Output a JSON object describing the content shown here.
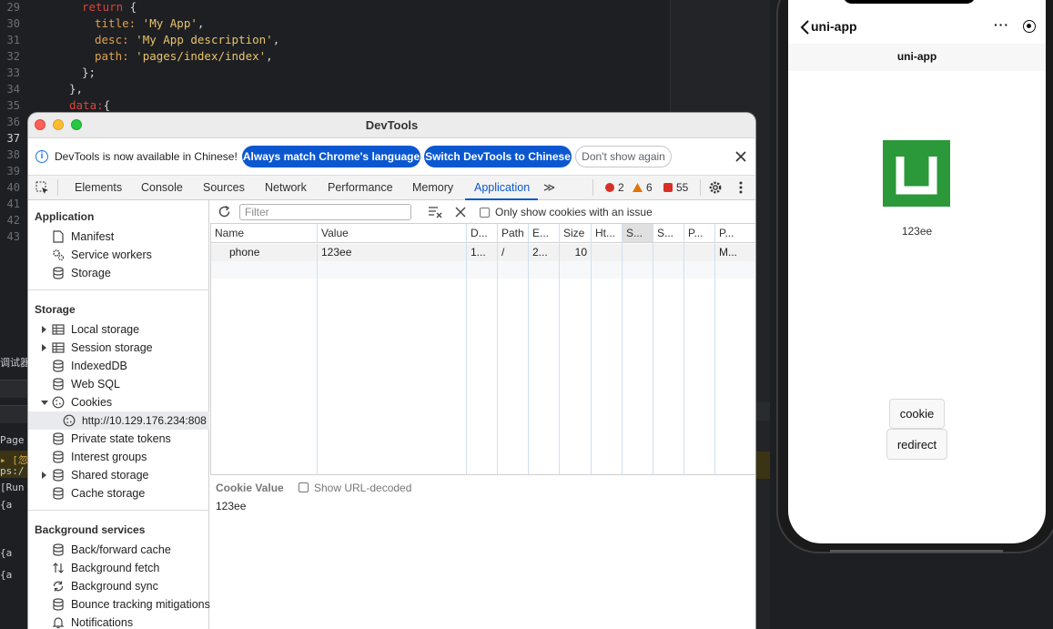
{
  "editor": {
    "line_numbers": [
      "29",
      "30",
      "31",
      "32",
      "33",
      "34",
      "35",
      "36",
      "37",
      "38",
      "39",
      "40",
      "41",
      "42",
      "43"
    ],
    "active_line": "37",
    "code": {
      "l29_kw": "return",
      "l29_brace": " {",
      "l30_key": "title:",
      "l30_val": " 'My App'",
      "l30_end": ",",
      "l31_key": "desc:",
      "l31_val": " 'My App description'",
      "l31_end": ",",
      "l32_key": "path:",
      "l32_val": " 'pages/index/index'",
      "l32_end": ",",
      "l33": "};",
      "l34": "},",
      "l35_key": "data:",
      "l35_brace": "{"
    }
  },
  "console_peek": {
    "label": "调试器",
    "page": "Page",
    "warn": "▸ [忽",
    "ps": "ps:/",
    "run": "[Run",
    "obj": "{a"
  },
  "phone": {
    "nav_title": "uni-app",
    "capsule_dots": "···",
    "page_header": "uni-app",
    "text": "123ee",
    "cookie_button": "cookie",
    "redirect_button": "redirect"
  },
  "devtools": {
    "window_title": "DevTools",
    "infobar": {
      "message": "DevTools is now available in Chinese!",
      "btn_match": "Always match Chrome's language",
      "btn_switch": "Switch DevTools to Chinese",
      "btn_dismiss": "Don't show again"
    },
    "tabs": [
      "Elements",
      "Console",
      "Sources",
      "Network",
      "Performance",
      "Memory",
      "Application"
    ],
    "active_tab": "Application",
    "more_tabs": "≫",
    "counts": {
      "errors": "2",
      "warnings": "6",
      "issues": "55"
    },
    "sidebar": {
      "application_header": "Application",
      "application_items": [
        "Manifest",
        "Service workers",
        "Storage"
      ],
      "storage_header": "Storage",
      "storage_items": [
        "Local storage",
        "Session storage",
        "IndexedDB",
        "Web SQL",
        "Cookies",
        "http://10.129.176.234:808",
        "Private state tokens",
        "Interest groups",
        "Shared storage",
        "Cache storage"
      ],
      "background_header": "Background services",
      "background_items": [
        "Back/forward cache",
        "Background fetch",
        "Background sync",
        "Bounce tracking mitigations",
        "Notifications"
      ]
    },
    "toolbar": {
      "filter_placeholder": "Filter",
      "only_issues_label": "Only show cookies with an issue"
    },
    "table": {
      "headers": [
        "Name",
        "Value",
        "D...",
        "Path",
        "E...",
        "Size",
        "Ht...",
        "S...",
        "S...",
        "P...",
        "P..."
      ],
      "rows": [
        [
          "phone",
          "123ee",
          "1...",
          "/",
          "2...",
          "10",
          "",
          "",
          "",
          "",
          "M..."
        ]
      ]
    },
    "cookie_value": {
      "label": "Cookie Value",
      "decode_label": "Show URL-decoded",
      "value": "123ee"
    },
    "colors": {
      "accent": "#0b57d0",
      "logo_green": "#2b9939",
      "error": "#d93025",
      "warning": "#e37400"
    }
  }
}
